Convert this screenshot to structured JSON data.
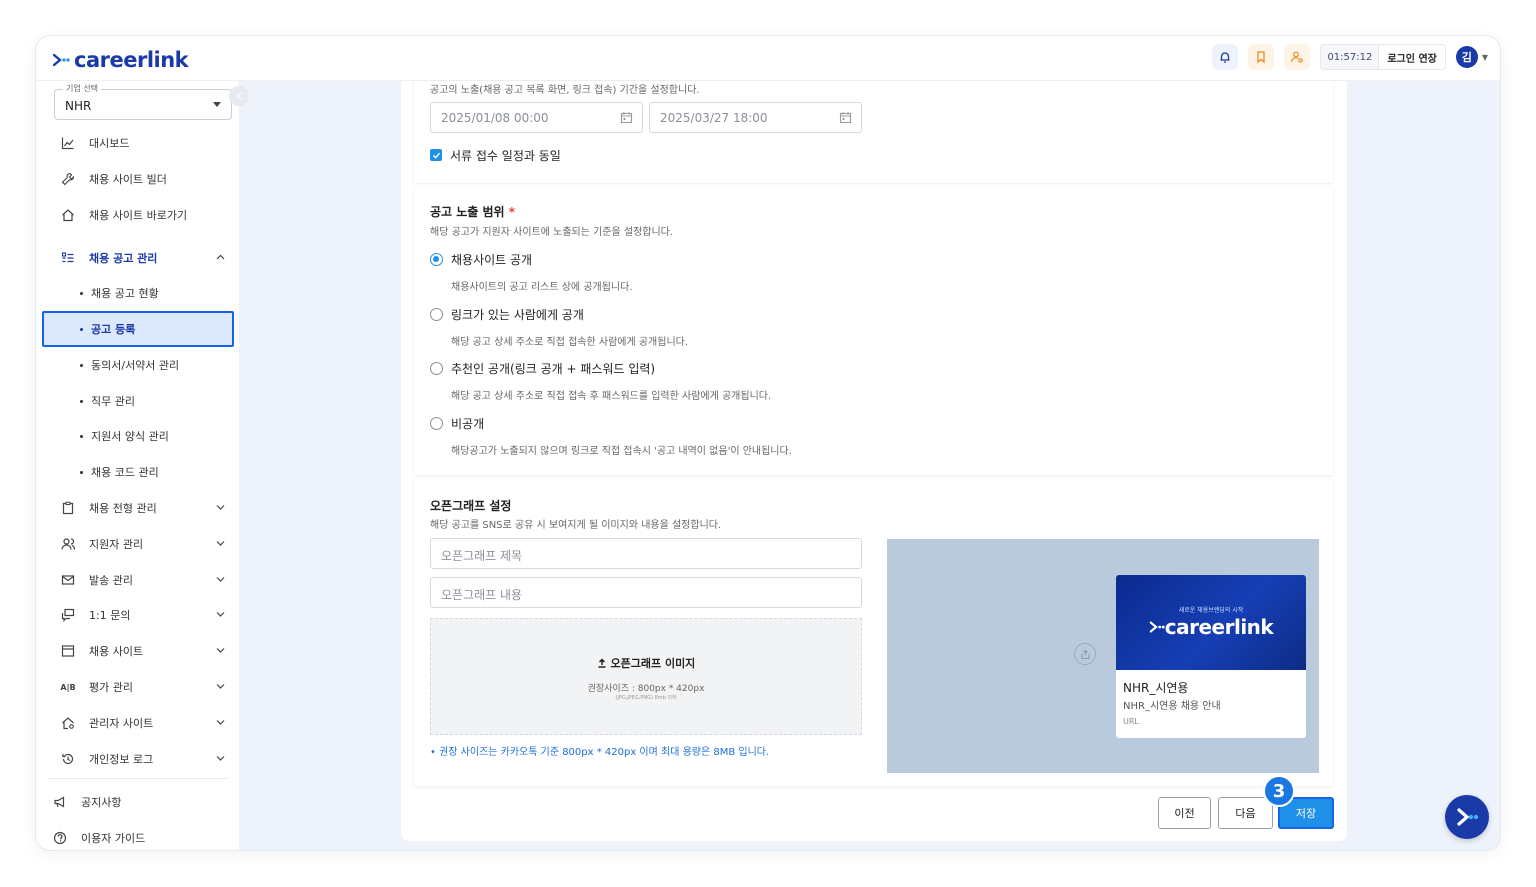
{
  "header": {
    "logo_text": "careerlink",
    "timer": "01:57:12",
    "extend_label": "로그인 연장",
    "avatar_initial": "김",
    "colors": {
      "brand": "#1a3aa8",
      "accent": "#1e90e8"
    }
  },
  "sidebar": {
    "company_legend": "기업 선택",
    "company_value": "NHR",
    "items": [
      {
        "label": "대시보드",
        "icon": "chart-icon"
      },
      {
        "label": "채용 사이트 빌더",
        "icon": "wrench-icon"
      },
      {
        "label": "채용 사이트 바로가기",
        "icon": "home-icon"
      },
      {
        "label": "채용 공고 관리",
        "icon": "list-icon",
        "expanded": true
      },
      {
        "label": "채용 전형 관리",
        "icon": "clipboard-icon"
      },
      {
        "label": "지원자 관리",
        "icon": "users-icon"
      },
      {
        "label": "발송 관리",
        "icon": "mail-icon"
      },
      {
        "label": "1:1 문의",
        "icon": "chat-icon"
      },
      {
        "label": "채용 사이트",
        "icon": "window-icon"
      },
      {
        "label": "평가 관리",
        "icon": "ab-icon"
      },
      {
        "label": "관리자 사이트",
        "icon": "admin-home-icon"
      },
      {
        "label": "개인정보 로그",
        "icon": "history-icon"
      }
    ],
    "sub_items": [
      "채용 공고 현황",
      "공고 등록",
      "동의서/서약서 관리",
      "직무 관리",
      "지원서 양식 관리",
      "채용 코드 관리"
    ],
    "footer": [
      {
        "label": "공지사항",
        "icon": "megaphone-icon"
      },
      {
        "label": "이용자 가이드",
        "icon": "help-icon"
      }
    ]
  },
  "exposure_period": {
    "desc": "공고의 노출(채용 공고 목록 화면, 링크 접속) 기간을 설정합니다.",
    "start": "2025/01/08 00:00",
    "end": "2025/03/27 18:00",
    "same_as_checkbox": "서류 접수 일정과 동일"
  },
  "exposure_scope": {
    "title": "공고 노출 범위",
    "required_mark": "*",
    "desc": "해당 공고가 지원자 사이트에 노출되는 기준을 설정합니다.",
    "options": [
      {
        "label": "채용사이트 공개",
        "desc": "채용사이트의 공고 리스트 상에 공개됩니다.",
        "selected": true
      },
      {
        "label": "링크가 있는 사람에게 공개",
        "desc": "해당 공고 상세 주소로 직접 접속한 사람에게 공개됩니다.",
        "selected": false
      },
      {
        "label": "추천인 공개(링크 공개 + 패스워드 입력)",
        "desc": "해당 공고 상세 주소로 직접 접속 후 패스워드를 입력한 사람에게 공개됩니다.",
        "selected": false
      },
      {
        "label": "비공개",
        "desc": "해당공고가 노출되지 않으며 링크로 직접 접속시 '공고 내역이 없음'이 안내됩니다.",
        "selected": false
      }
    ]
  },
  "opengraph": {
    "title": "오픈그래프 설정",
    "desc": "해당 공고를 SNS로 공유 시 보여지게 될 이미지와 내용을 설정합니다.",
    "title_placeholder": "오픈그래프 제목",
    "content_placeholder": "오픈그래프 내용",
    "upload_label": "오픈그래프 이미지",
    "upload_size": "권장사이즈 : 800px * 420px",
    "upload_types": "(JPG,JPEG,PNG) 8mb 이하",
    "note": "• 권장 사이즈는 카카오톡 기준 800px * 420px 이며 최대 용량은 8MB 입니다.",
    "preview": {
      "tagline": "새로운 채용브랜딩의 시작",
      "logo_text": "careerlink",
      "name": "NHR_시연용",
      "subtitle": "NHR_시연용 채용 안내",
      "url": "URL"
    }
  },
  "actions": {
    "prev": "이전",
    "next": "다음",
    "save": "저장",
    "step": "3"
  }
}
